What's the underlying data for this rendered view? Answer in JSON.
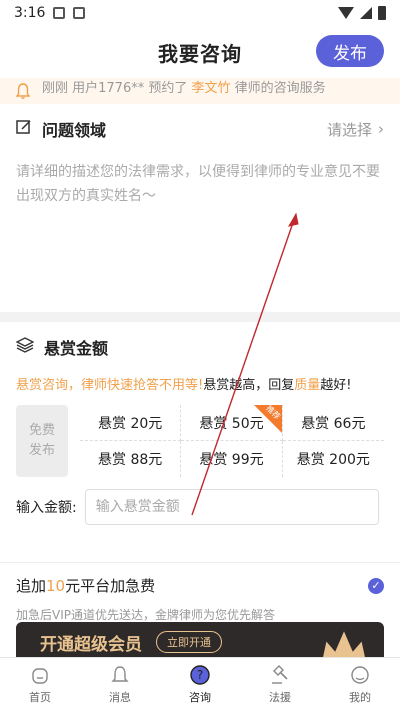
{
  "status": {
    "time": "3:16"
  },
  "header": {
    "title": "我要咨询",
    "publish_label": "发布"
  },
  "notice": {
    "prefix": "刚刚 用户1776** 预约了",
    "lawyer": "李文竹",
    "suffix": "律师的咨询服务"
  },
  "question": {
    "title": "问题领域",
    "select_label": "请选择",
    "chevron": "›",
    "description": "请详细的描述您的法律需求，以便得到律师的专业意见不要出现双方的真实姓名～"
  },
  "reward": {
    "title": "悬赏金额",
    "tip_a": "悬赏咨询，律师快速抢答不用等!",
    "tip_b": "悬赏越高，回复",
    "tip_c": "质量",
    "tip_d": "越好!",
    "free_line1": "免费",
    "free_line2": "发布",
    "tag_label": "推荐",
    "options": [
      "悬赏 20元",
      "悬赏 50元",
      "悬赏 66元",
      "悬赏 88元",
      "悬赏 99元",
      "悬赏 200元"
    ],
    "input_label": "输入金额:",
    "input_placeholder": "输入悬赏金额"
  },
  "urgent": {
    "title_a": "追加",
    "title_b": "10",
    "title_c": "元平台加急费",
    "sub": "加急后VIP通道优先送达，金牌律师为您优先解答",
    "check": "✓"
  },
  "vip": {
    "title": "开通超级会员",
    "btn": "立即开通"
  },
  "tabs": [
    {
      "label": "首页",
      "icon": "home-icon"
    },
    {
      "label": "消息",
      "icon": "bell-icon"
    },
    {
      "label": "咨询",
      "icon": "question-icon"
    },
    {
      "label": "法援",
      "icon": "gavel-icon"
    },
    {
      "label": "我的",
      "icon": "user-icon"
    }
  ],
  "colors": {
    "accent": "#5b61d9",
    "orange": "#f0a04b",
    "tag": "#f37b2e",
    "annotation": "#c0282d"
  }
}
